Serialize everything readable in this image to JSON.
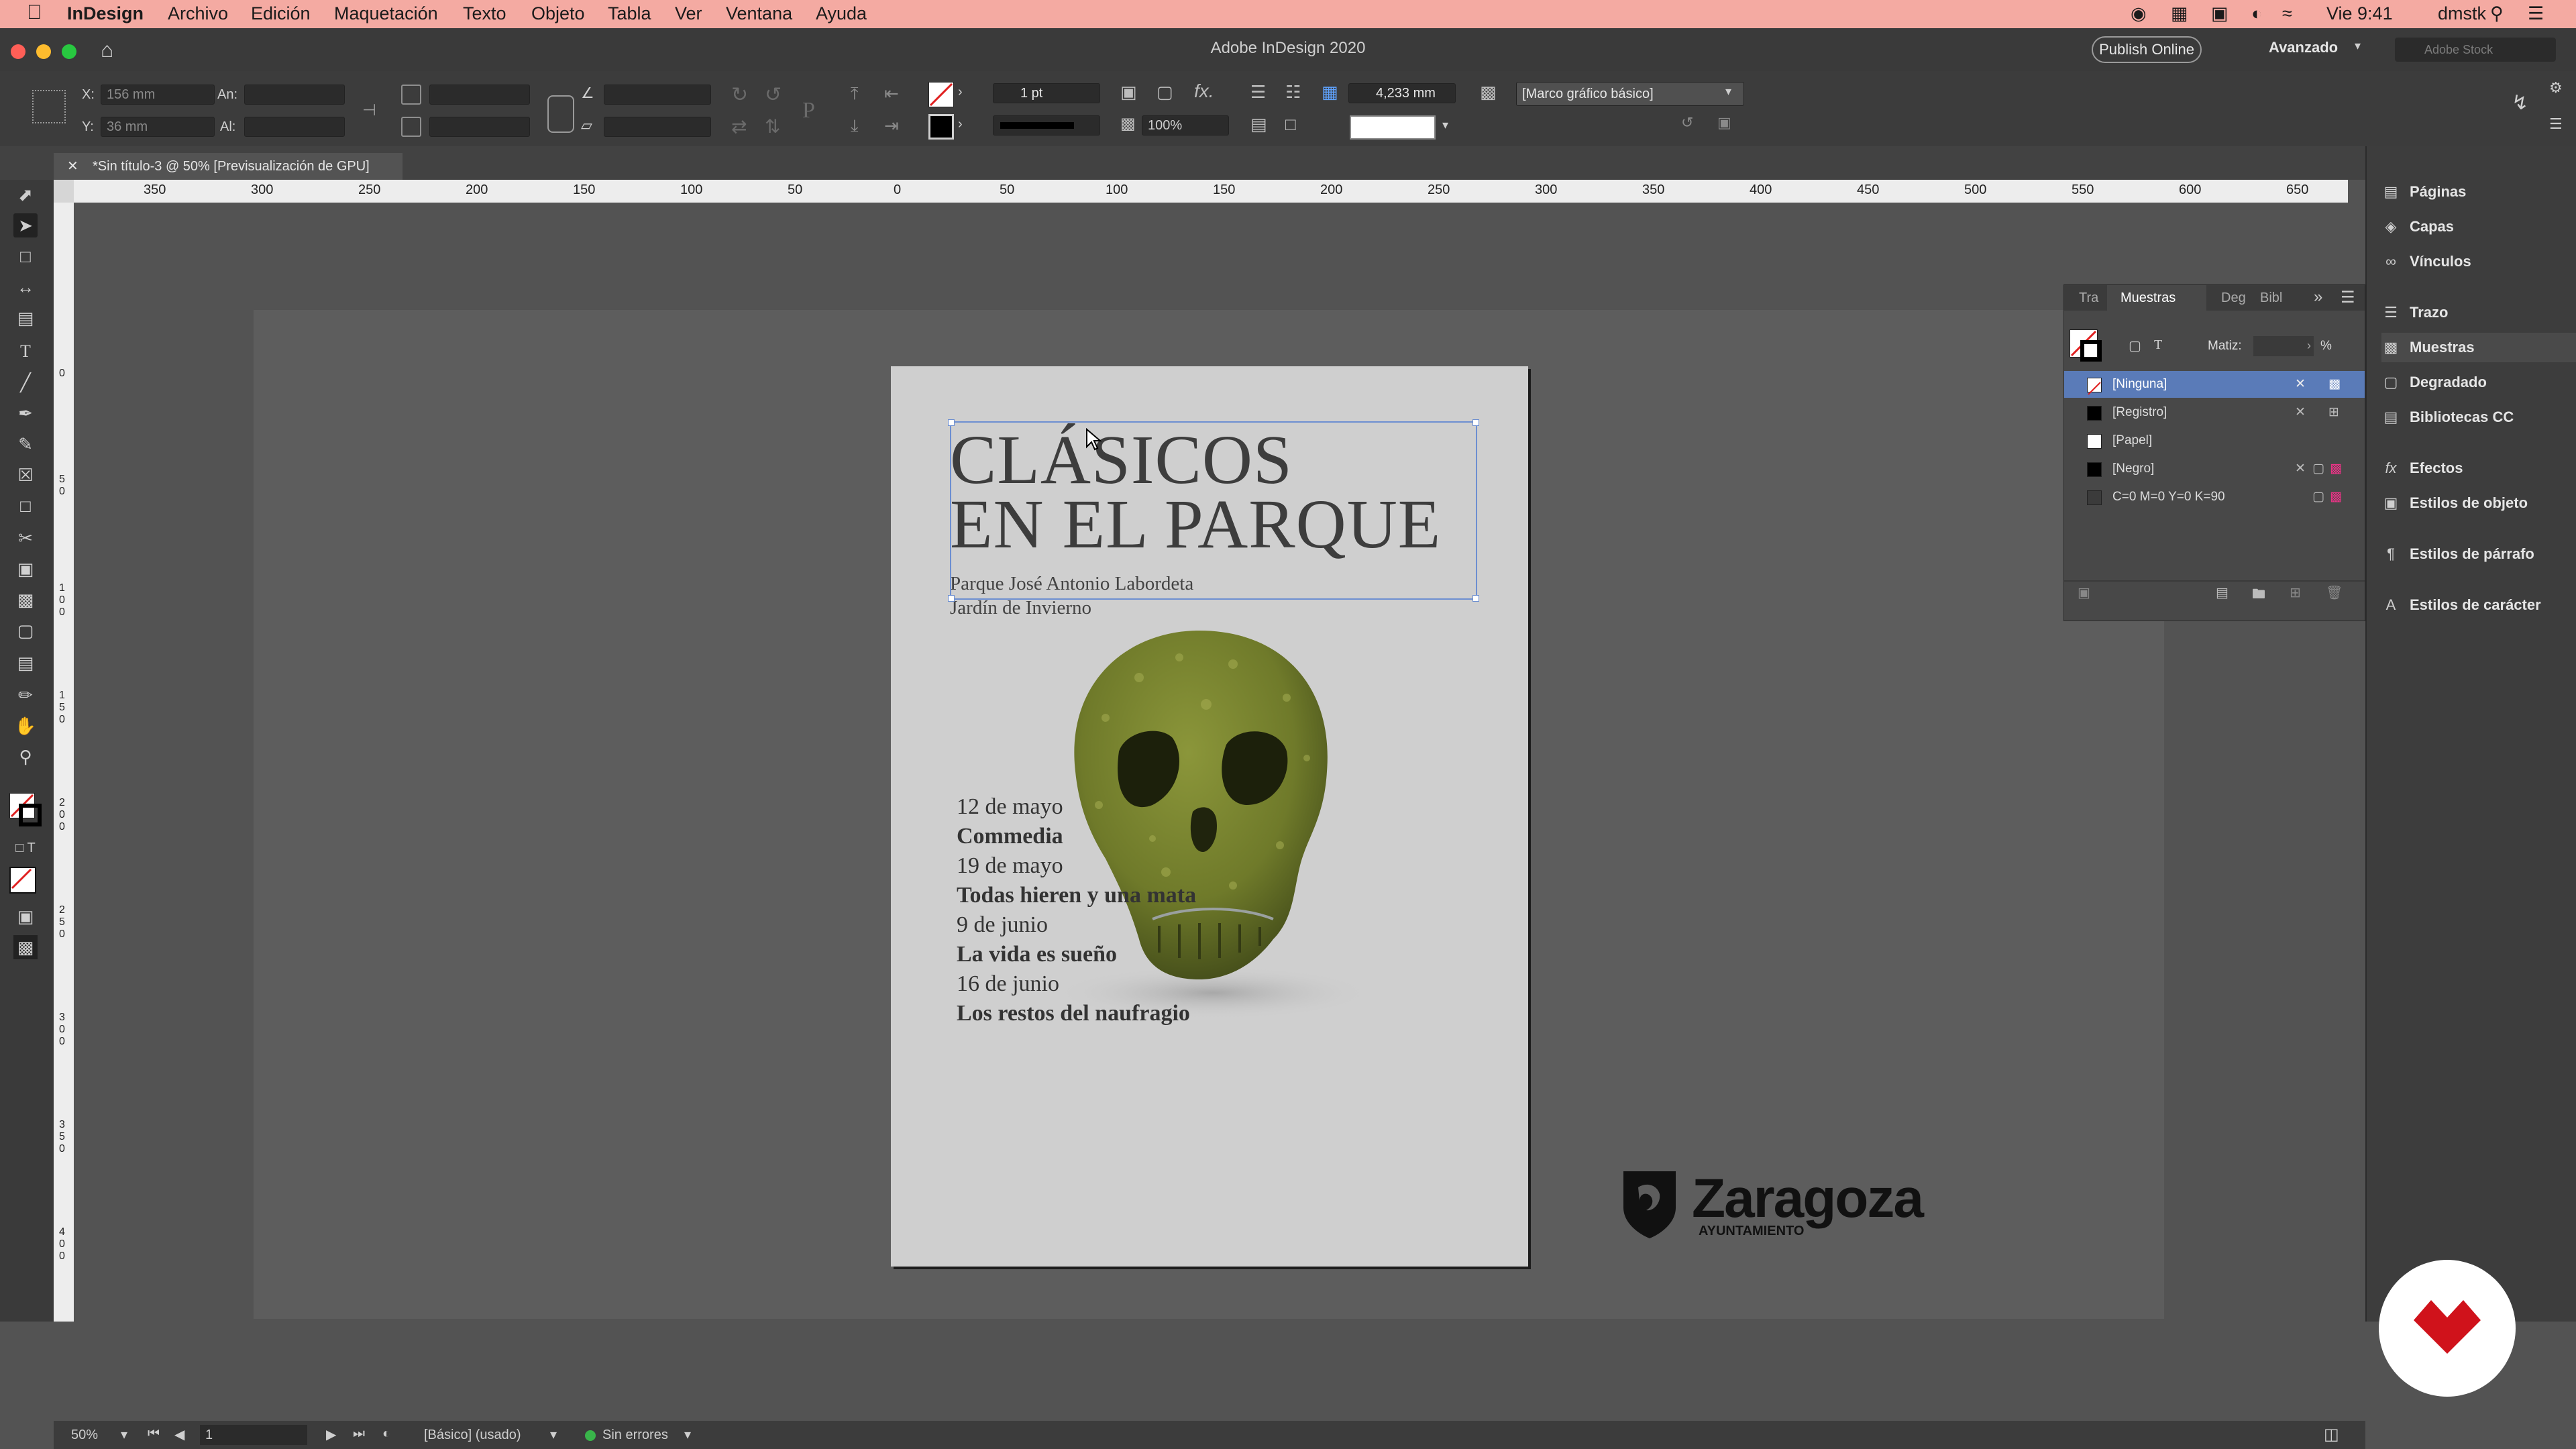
{
  "menubar": {
    "app": "InDesign",
    "items": [
      "Archivo",
      "Edición",
      "Maquetación",
      "Texto",
      "Objeto",
      "Tabla",
      "Ver",
      "Ventana",
      "Ayuda"
    ],
    "clock": "Vie 9:41",
    "user": "dmstk"
  },
  "window": {
    "title": "Adobe InDesign 2020",
    "publish_label": "Publish Online",
    "workspace": "Avanzado",
    "search_placeholder": "Adobe Stock"
  },
  "control_panel": {
    "x_label": "X:",
    "x_value": "156 mm",
    "y_label": "Y:",
    "y_value": "36 mm",
    "w_label": "An:",
    "h_label": "Al:",
    "stroke_weight": "1 pt",
    "opacity": "100%",
    "offset_value": "4,233 mm",
    "object_style": "[Marco gráfico básico]"
  },
  "document": {
    "tab_label": "*Sin título-3 @ 50% [Previsualización de GPU]"
  },
  "ruler": {
    "h_ticks": [
      "350",
      "300",
      "250",
      "200",
      "150",
      "100",
      "50",
      "0",
      "50",
      "100",
      "150",
      "200",
      "250",
      "300",
      "350",
      "400",
      "450",
      "500",
      "550",
      "600",
      "650"
    ],
    "v_ticks": [
      "0",
      "5 0",
      "1 0 0",
      "1 5 0",
      "2 0 0",
      "2 5 0",
      "3 0 0",
      "3 5 0",
      "4 0 0"
    ]
  },
  "poster": {
    "title_line1": "CLÁSICOS",
    "title_line2": "EN EL PARQUE",
    "subtitle_line1": "Parque José Antonio Labordeta",
    "subtitle_line2": "Jardín de Invierno",
    "schedule": [
      {
        "date": "12 de mayo",
        "play": "Commedia"
      },
      {
        "date": "19 de mayo",
        "play": "Todas hieren y una mata"
      },
      {
        "date": "9 de junio",
        "play": "La vida es sueño"
      },
      {
        "date": "16 de junio",
        "play": "Los restos del naufragio"
      }
    ]
  },
  "logo": {
    "name": "Zaragoza",
    "caption": "AYUNTAMIENTO"
  },
  "swatches_panel": {
    "tabs": [
      "Tra",
      "Muestras",
      "Deg",
      "Bibl"
    ],
    "tint_label": "Matiz:",
    "tint_unit": "%",
    "items": [
      {
        "name": "[Ninguna]",
        "color": "none",
        "selected": true
      },
      {
        "name": "[Registro]",
        "color": "#000000",
        "selected": false
      },
      {
        "name": "[Papel]",
        "color": "#ffffff",
        "selected": false
      },
      {
        "name": "[Negro]",
        "color": "#000000",
        "selected": false
      },
      {
        "name": "C=0 M=0 Y=0 K=90",
        "color": "#3b3b3b",
        "selected": false
      }
    ]
  },
  "right_dock": {
    "items": [
      "Páginas",
      "Capas",
      "Vínculos",
      "Trazo",
      "Muestras",
      "Degradado",
      "Bibliotecas CC",
      "Efectos",
      "Estilos de objeto",
      "Estilos de párrafo",
      "Estilos de carácter"
    ]
  },
  "statusbar": {
    "zoom": "50%",
    "page": "1",
    "style": "[Básico] (usado)",
    "preflight": "Sin errores"
  },
  "colors": {
    "menubar": "#f4aaa2",
    "selection_blue": "#6d8fd1",
    "moss_green": "#6f7a2a",
    "brand_red": "#d0121b"
  }
}
